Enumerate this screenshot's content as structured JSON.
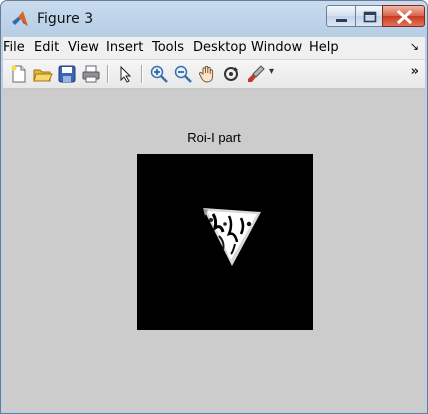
{
  "window": {
    "title": "Figure 3",
    "controls": [
      "minimize-icon",
      "maximize-icon",
      "close-icon"
    ]
  },
  "menubar": {
    "items": [
      "File",
      "Edit",
      "View",
      "Insert",
      "Tools",
      "Desktop",
      "Window",
      "Help"
    ],
    "overflow_icon": "chevron-icon"
  },
  "toolbar": {
    "buttons": [
      "new-figure-icon",
      "open-file-icon",
      "save-icon",
      "print-icon",
      "edit-plot-arrow-icon",
      "zoom-in-icon",
      "zoom-out-icon",
      "pan-hand-icon",
      "rotate-3d-icon",
      "data-brush-icon"
    ],
    "overflow_icon": "double-chevron-icon"
  },
  "figure": {
    "axes_title": "Roi-I part",
    "image_background": "#000000",
    "canvas_color": "#cccccc"
  }
}
